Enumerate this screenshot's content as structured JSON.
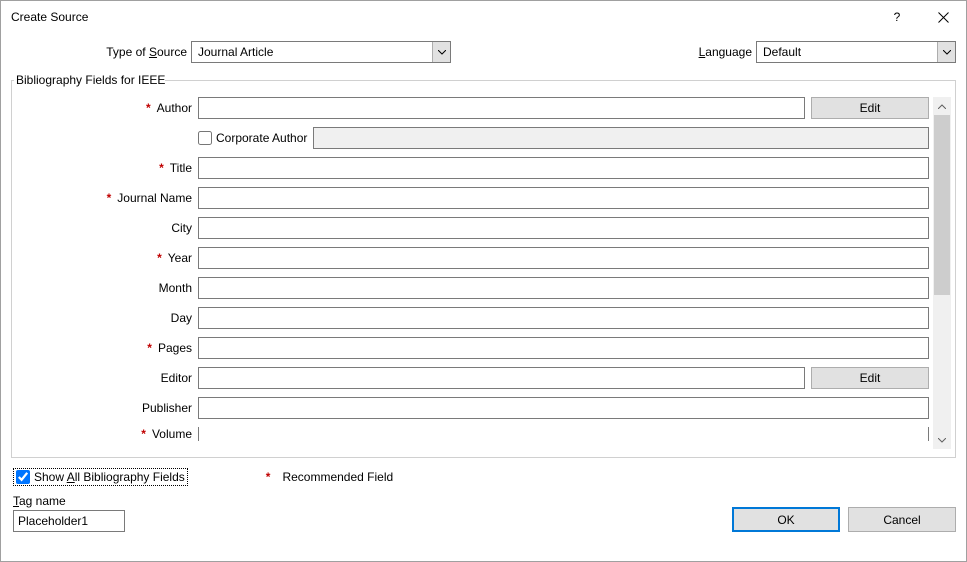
{
  "window": {
    "title": "Create Source"
  },
  "top": {
    "type_label": "Type of Source",
    "type_value": "Journal Article",
    "language_label": "Language",
    "language_value": "Default"
  },
  "fieldset": {
    "legend": "Bibliography Fields for IEEE"
  },
  "fields": {
    "author": {
      "label": "Author",
      "required": true,
      "value": "",
      "edit_label": "Edit"
    },
    "corporate": {
      "label": "Corporate Author",
      "checked": false,
      "value": ""
    },
    "title": {
      "label": "Title",
      "required": true,
      "value": ""
    },
    "journal": {
      "label": "Journal Name",
      "required": true,
      "value": ""
    },
    "city": {
      "label": "City",
      "required": false,
      "value": ""
    },
    "year": {
      "label": "Year",
      "required": true,
      "value": ""
    },
    "month": {
      "label": "Month",
      "required": false,
      "value": ""
    },
    "day": {
      "label": "Day",
      "required": false,
      "value": ""
    },
    "pages": {
      "label": "Pages",
      "required": true,
      "value": ""
    },
    "editor": {
      "label": "Editor",
      "required": false,
      "value": "",
      "edit_label": "Edit"
    },
    "publisher": {
      "label": "Publisher",
      "required": false,
      "value": ""
    },
    "volume": {
      "label": "Volume",
      "required": true,
      "value": ""
    }
  },
  "footer": {
    "show_all_label": "Show All Bibliography Fields",
    "show_all_checked": true,
    "recommended_label": "Recommended Field",
    "tag_name_label": "Tag name",
    "tag_name_value": "Placeholder1",
    "ok_label": "OK",
    "cancel_label": "Cancel"
  },
  "asterisk": "*"
}
